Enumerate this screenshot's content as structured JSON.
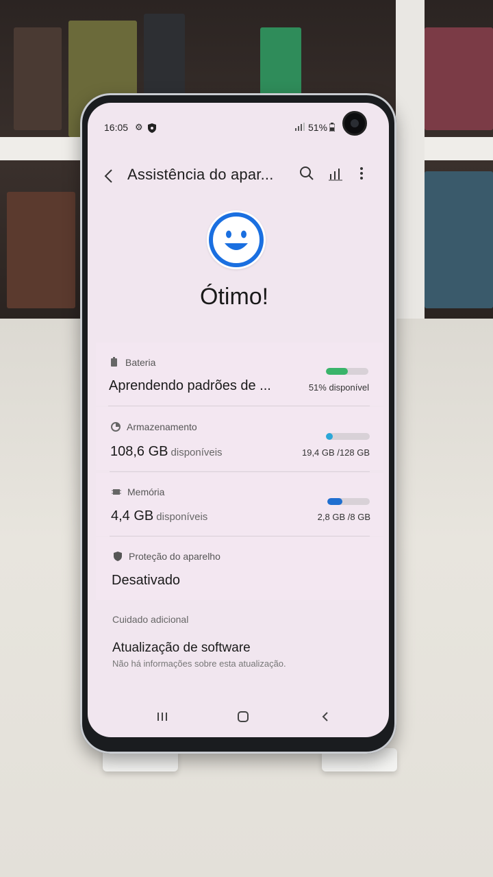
{
  "status_bar": {
    "time": "16:05",
    "battery": "51%"
  },
  "header": {
    "title": "Assistência do apar...",
    "back_icon": "back-arrow-icon",
    "search_icon": "search-icon",
    "stats_icon": "bar-chart-icon",
    "more_icon": "more-vertical-icon"
  },
  "summary": {
    "face_icon": "smiley-face-icon",
    "status": "Ótimo!",
    "accent_color": "#1a6fe0"
  },
  "battery": {
    "label": "Bateria",
    "value": "Aprendendo padrões de ...",
    "right": "51% disponível",
    "level": 0.51,
    "color": "#39b46a"
  },
  "storage": {
    "label": "Armazenamento",
    "value": "108,6 GB",
    "unit": "disponíveis",
    "right": "19,4 GB /128 GB",
    "level": 0.15,
    "color": "#2ba7d8"
  },
  "memory": {
    "label": "Memória",
    "value": "4,4 GB",
    "unit": "disponíveis",
    "right": "2,8 GB /8 GB",
    "level": 0.35,
    "color": "#1f6fd0"
  },
  "protection": {
    "label": "Proteção do aparelho",
    "value": "Desativado"
  },
  "additional": {
    "section": "Cuidado adicional",
    "title": "Atualização de software",
    "subtitle": "Não há informações sobre esta atualização."
  },
  "nav": {
    "recents_icon": "recents-icon",
    "home_icon": "home-icon",
    "back_icon": "back-icon"
  }
}
